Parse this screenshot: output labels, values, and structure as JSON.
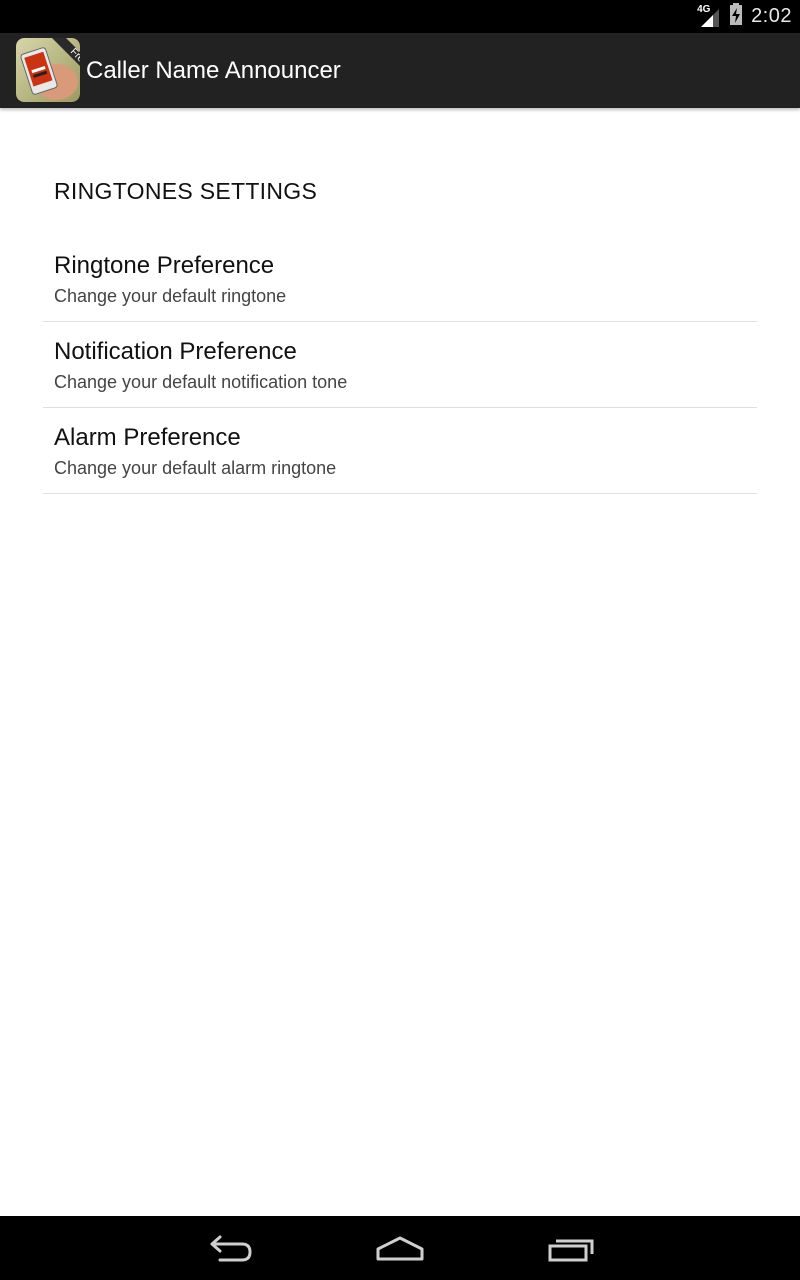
{
  "status_bar": {
    "network": "4G",
    "time": "2:02",
    "icons": [
      "signal-icon",
      "battery-icon"
    ]
  },
  "action_bar": {
    "title": "Caller Name Announcer",
    "icon_badge": "Free",
    "icon": "app-icon"
  },
  "settings": {
    "section_header": "RINGTONES SETTINGS",
    "items": [
      {
        "title": "Ringtone Preference",
        "summary": "Change your default ringtone"
      },
      {
        "title": "Notification Preference",
        "summary": "Change your default notification tone"
      },
      {
        "title": "Alarm Preference",
        "summary": "Change your default alarm ringtone"
      }
    ]
  },
  "nav_bar": {
    "icons": [
      "back-icon",
      "home-icon",
      "recent-apps-icon"
    ]
  },
  "colors": {
    "status_bar": "#000000",
    "action_bar": "#222222",
    "background": "#ffffff",
    "divider": "#e0e0e0"
  }
}
